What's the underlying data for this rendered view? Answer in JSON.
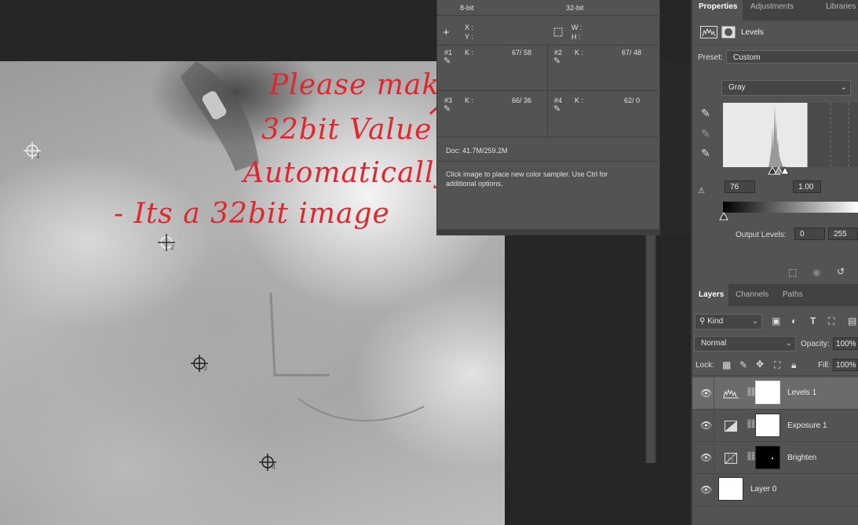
{
  "info_panel": {
    "col_8bit": "8-bit",
    "col_32bit": "32-bit",
    "xy": {
      "x": "X :",
      "y": "Y :"
    },
    "wh": {
      "w": "W :",
      "h": "H :"
    },
    "samplers": [
      {
        "id": "#1",
        "channel": "K :",
        "value": "67/ 58"
      },
      {
        "id": "#2",
        "channel": "K :",
        "value": "67/ 48"
      },
      {
        "id": "#3",
        "channel": "K :",
        "value": "66/ 36"
      },
      {
        "id": "#4",
        "channel": "K :",
        "value": "62/ 0"
      }
    ],
    "doc": "Doc: 41.7M/259.2M",
    "hint": "Click image to place new color sampler.  Use Ctrl for additional options."
  },
  "properties": {
    "tabs": [
      "Properties",
      "Adjustments",
      "Libraries"
    ],
    "title": "Levels",
    "preset_label": "Preset:",
    "preset_value": "Custom",
    "channel_value": "Gray",
    "input_black": "76",
    "input_gamma": "1.00",
    "output_label": "Output Levels:",
    "output_black": "0",
    "output_white": "255"
  },
  "layers": {
    "tabs": [
      "Layers",
      "Channels",
      "Paths"
    ],
    "filter_kind": "Kind",
    "blend_mode": "Normal",
    "opacity_label": "Opacity:",
    "opacity_value": "100%",
    "lock_label": "Lock:",
    "fill_label": "Fill:",
    "fill_value": "100%",
    "items": [
      {
        "name": "Levels 1",
        "selected": true
      },
      {
        "name": "Exposure 1",
        "selected": false
      },
      {
        "name": "Brighten",
        "selected": false
      },
      {
        "name": "Layer 0",
        "selected": false
      }
    ]
  },
  "canvas": {
    "sampler_labels": [
      "1",
      "2",
      "3",
      "4"
    ]
  },
  "annotation": {
    "line1": "Please make",
    "line2": "32bit Value",
    "line3": "Automatically",
    "line4": "- Its a 32bit image",
    "color": "#e0262e"
  }
}
